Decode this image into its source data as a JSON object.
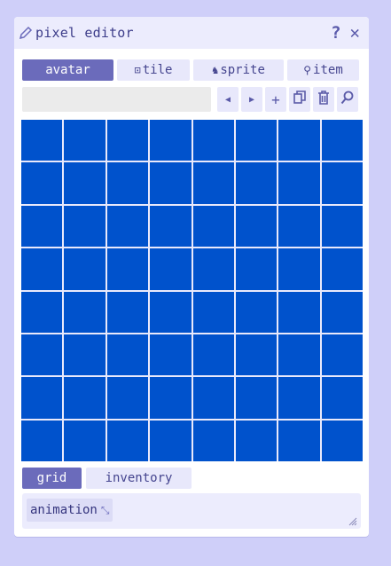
{
  "window": {
    "title": "pixel editor",
    "help": "?",
    "close": "✕"
  },
  "tabs": [
    {
      "label": "avatar",
      "icon": "",
      "active": true
    },
    {
      "label": "tile",
      "icon": "⊡",
      "active": false
    },
    {
      "label": "sprite",
      "icon": "♞",
      "active": false
    },
    {
      "label": "item",
      "icon": "⚲",
      "active": false
    }
  ],
  "toolbar": {
    "name_value": "",
    "prev": "◀",
    "next": "▶",
    "add": "+",
    "copy": "⧉",
    "delete": "🗑",
    "search": "🔍"
  },
  "canvas": {
    "rows": 8,
    "cols": 8,
    "color": "#0052cc"
  },
  "bottom_tabs": [
    {
      "label": "grid",
      "active": true
    },
    {
      "label": "inventory",
      "active": false
    }
  ],
  "panel": {
    "chip_label": "animation",
    "chip_icon": "⤡"
  },
  "colors": {
    "accent": "#6b6bbb",
    "background": "#cfcff9",
    "pixel": "#0052cc"
  }
}
